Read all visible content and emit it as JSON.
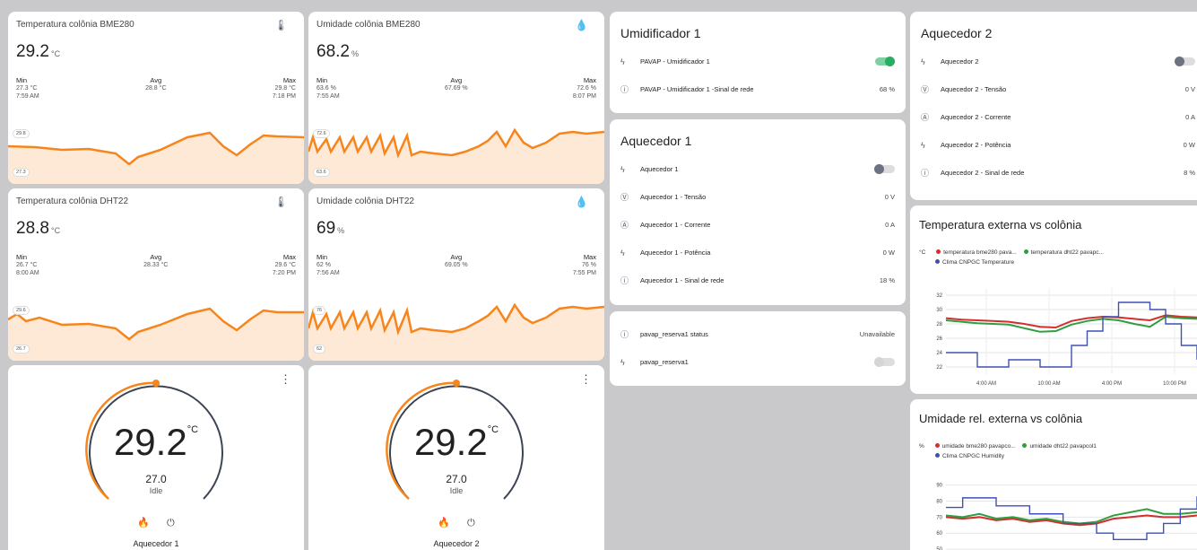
{
  "colors": {
    "orange": "#f7851b",
    "green_toggle": "#27ae60",
    "red": "#d32f2f",
    "green": "#2e9e3e",
    "blue": "#3f51b5"
  },
  "sensors": [
    {
      "title": "Temperatura colônia BME280",
      "icon": "thermometer-icon",
      "value": "29.2",
      "unit": "°C",
      "min_label": "Min",
      "min": "27.3 °C",
      "min_time": "7:59 AM",
      "avg_label": "Avg",
      "avg": "28.8 °C",
      "max_label": "Max",
      "max": "29.8 °C",
      "max_time": "7:18 PM",
      "hi": "29.8",
      "lo": "27.3"
    },
    {
      "title": "Umidade colônia BME280",
      "icon": "water-drop-icon",
      "value": "68.2",
      "unit": "%",
      "min_label": "Min",
      "min": "63.6 %",
      "min_time": "7:55 AM",
      "avg_label": "Avg",
      "avg": "67.69 %",
      "max_label": "Max",
      "max": "72.6 %",
      "max_time": "8:07 PM",
      "hi": "72.6",
      "lo": "63.6"
    },
    {
      "title": "Temperatura colônia DHT22",
      "icon": "thermometer-icon",
      "value": "28.8",
      "unit": "°C",
      "min_label": "Min",
      "min": "26.7 °C",
      "min_time": "8:00 AM",
      "avg_label": "Avg",
      "avg": "28.33 °C",
      "max_label": "Max",
      "max": "29.6 °C",
      "max_time": "7:20 PM",
      "hi": "29.6",
      "lo": "26.7"
    },
    {
      "title": "Umidade colônia DHT22",
      "icon": "water-drop-icon",
      "value": "69",
      "unit": "%",
      "min_label": "Min",
      "min": "62 %",
      "min_time": "7:56 AM",
      "avg_label": "Avg",
      "avg": "69.05 %",
      "max_label": "Max",
      "max": "76 %",
      "max_time": "7:55 PM",
      "hi": "76",
      "lo": "62"
    }
  ],
  "thermostats": [
    {
      "current": "29.2",
      "unit": "°C",
      "target": "27.0",
      "state": "Idle",
      "name": "Aquecedor 1"
    },
    {
      "current": "29.2",
      "unit": "°C",
      "target": "27.0",
      "state": "Idle",
      "name": "Aquecedor 2"
    }
  ],
  "umidificador": {
    "title": "Umidificador 1",
    "rows": [
      {
        "icon": "flash-icon",
        "label": "PAVAP - Umidificador 1",
        "toggle": true
      },
      {
        "icon": "info-icon",
        "label": "PAVAP - Umidificador 1 -Sinal de rede",
        "state": "68 %"
      }
    ]
  },
  "aquecedor1": {
    "title": "Aquecedor 1",
    "rows": [
      {
        "icon": "flash-icon",
        "label": "Aquecedor 1",
        "toggle": false
      },
      {
        "icon": "voltage-icon",
        "label": "Aquecedor 1 - Tensão",
        "state": "0 V"
      },
      {
        "icon": "current-icon",
        "label": "Aquecedor 1 - Corrente",
        "state": "0 A"
      },
      {
        "icon": "flash-icon",
        "label": "Aquecedor 1 - Potência",
        "state": "0 W"
      },
      {
        "icon": "info-icon",
        "label": "Aquecedor 1 - Sinal de rede",
        "state": "18 %"
      }
    ]
  },
  "reserva": {
    "rows": [
      {
        "icon": "info-icon",
        "label": "pavap_reserva1 status",
        "state": "Unavailable"
      },
      {
        "icon": "flash-icon",
        "label": "pavap_reserva1",
        "toggle": false
      }
    ]
  },
  "aquecedor2": {
    "title": "Aquecedor 2",
    "rows": [
      {
        "icon": "flash-icon",
        "label": "Aquecedor 2",
        "toggle": false
      },
      {
        "icon": "voltage-icon",
        "label": "Aquecedor 2 - Tensão",
        "state": "0 V"
      },
      {
        "icon": "current-icon",
        "label": "Aquecedor 2 - Corrente",
        "state": "0 A"
      },
      {
        "icon": "flash-icon",
        "label": "Aquecedor 2 - Potência",
        "state": "0 W"
      },
      {
        "icon": "info-icon",
        "label": "Aquecedor 2 - Sinal de rede",
        "state": "8 %"
      }
    ]
  },
  "chart_data": [
    {
      "type": "line",
      "title": "Temperatura externa vs colônia",
      "ylabel": "°C",
      "ylim": [
        21,
        33
      ],
      "yticks": [
        "32",
        "30",
        "28",
        "26",
        "24",
        "22"
      ],
      "xticks": [
        "4:00 AM",
        "10:00 AM",
        "4:00 PM",
        "10:00 PM"
      ],
      "legend": [
        "temperatura bme280 pava...",
        "temperatura dht22 pavapc...",
        "Clima CNPGC Temperature"
      ],
      "series": [
        {
          "name": "temperatura bme280 pava...",
          "color": "#d32f2f",
          "values": [
            28.8,
            28.6,
            28.5,
            28.4,
            28.3,
            28.0,
            27.6,
            27.5,
            28.4,
            28.8,
            29.0,
            28.9,
            28.7,
            28.5,
            29.2,
            29.0,
            28.9
          ]
        },
        {
          "name": "temperatura dht22 pavapc...",
          "color": "#2e9e3e",
          "values": [
            28.5,
            28.3,
            28.1,
            28.0,
            27.9,
            27.4,
            26.9,
            27.0,
            27.9,
            28.4,
            28.7,
            28.5,
            28.0,
            27.6,
            29.0,
            28.8,
            28.7
          ]
        },
        {
          "name": "Clima CNPGC Temperature",
          "color": "#3f51b5",
          "values": [
            24,
            24,
            22,
            22,
            23,
            23,
            22,
            22,
            25,
            27,
            29,
            31,
            31,
            30,
            28,
            25,
            23
          ]
        }
      ]
    },
    {
      "type": "line",
      "title": "Umidade rel. externa vs colônia",
      "ylabel": "%",
      "ylim": [
        45,
        92
      ],
      "yticks": [
        "90",
        "80",
        "70",
        "60",
        "50"
      ],
      "legend": [
        "umidade bme280 pavapco...",
        "umidade dht22 pavapcol1",
        "Clima CNPGC Humidity"
      ],
      "series": [
        {
          "name": "umidade bme280 pavapco...",
          "color": "#d32f2f",
          "values": [
            70,
            69,
            70,
            68,
            69,
            67,
            68,
            66,
            65,
            66,
            69,
            70,
            71,
            70,
            70,
            71
          ]
        },
        {
          "name": "umidade dht22 pavapcol1",
          "color": "#2e9e3e",
          "values": [
            71,
            70,
            72,
            69,
            70,
            68,
            69,
            67,
            66,
            67,
            71,
            73,
            75,
            72,
            72,
            73
          ]
        },
        {
          "name": "Clima CNPGC Humidity",
          "color": "#3f51b5",
          "values": [
            76,
            82,
            82,
            77,
            77,
            72,
            72,
            66,
            66,
            60,
            56,
            56,
            60,
            66,
            75,
            83
          ]
        }
      ]
    }
  ]
}
